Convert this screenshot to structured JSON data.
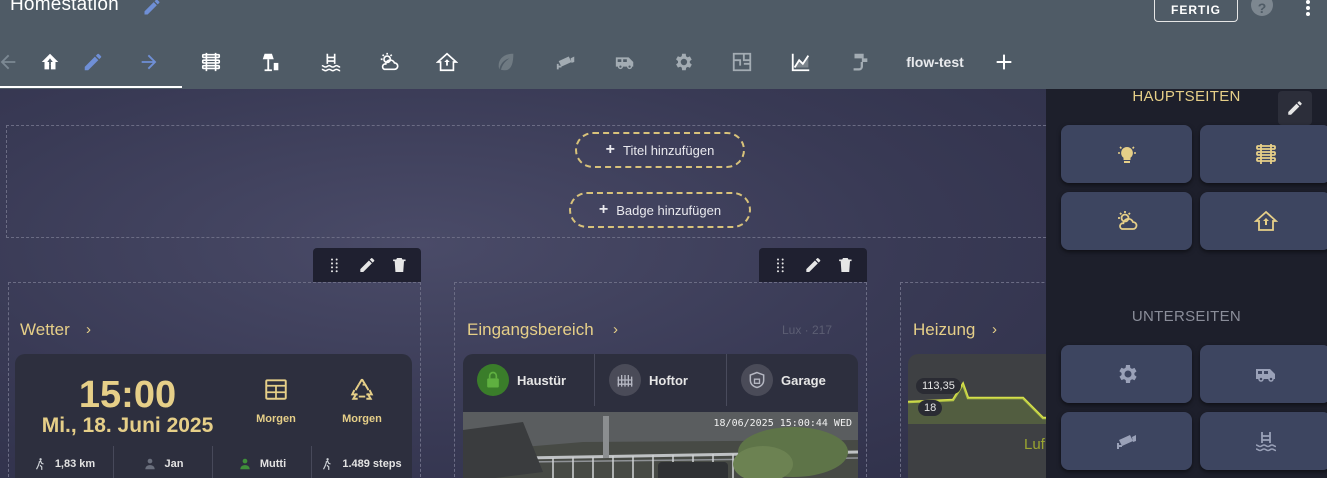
{
  "app": {
    "title": "Homestation",
    "done_label": "FERTIG",
    "help_glyph": "?"
  },
  "tabs": [
    {
      "icon": "back-arrow-icon"
    },
    {
      "icon": "home-tree-icon",
      "active": true
    },
    {
      "icon": "pencil-icon"
    },
    {
      "icon": "forward-arrow-icon"
    },
    {
      "icon": "radiator-icon"
    },
    {
      "icon": "outdoor-lamp-icon"
    },
    {
      "icon": "pool-icon"
    },
    {
      "icon": "weather-partly-cloudy-icon"
    },
    {
      "icon": "home-icon"
    },
    {
      "icon": "leaf-icon"
    },
    {
      "icon": "security-camera-icon"
    },
    {
      "icon": "van-icon"
    },
    {
      "icon": "gear-icon"
    },
    {
      "icon": "floor-plan-icon"
    },
    {
      "icon": "chart-icon"
    },
    {
      "icon": "faucet-icon"
    },
    {
      "label": "flow-test"
    },
    {
      "icon": "plus-icon"
    }
  ],
  "main": {
    "add_title": "Titel hinzufügen",
    "add_badge": "Badge hinzufügen",
    "sections": {
      "weather": {
        "title": "Wetter",
        "chevron": "›",
        "time": "15:00",
        "date": "Mi., 18. Juni 2025",
        "tiles": [
          {
            "icon": "calendar-icon",
            "label": "Morgen"
          },
          {
            "icon": "recycle-icon",
            "label": "Morgen"
          }
        ],
        "stats": [
          {
            "icon": "walk-icon",
            "value": "1,83 km"
          },
          {
            "icon": "person-icon",
            "value": "Jan"
          },
          {
            "icon": "person-green-icon",
            "value": "Mutti"
          },
          {
            "icon": "walk-icon",
            "value": "1.489 steps"
          }
        ]
      },
      "entrance": {
        "title": "Eingangsbereich",
        "chevron": "›",
        "lux": "Lux · 217",
        "doors": [
          {
            "icon": "lock-icon",
            "label": "Haustür",
            "color": "#3a7d2a"
          },
          {
            "icon": "gate-icon",
            "label": "Hoftor",
            "color": "#4a4b58"
          },
          {
            "icon": "garage-shield-icon",
            "label": "Garage",
            "color": "#4a4b58"
          }
        ],
        "camera_timestamp": "18/06/2025 15:00:44 WED"
      },
      "heating": {
        "title": "Heizung",
        "chevron": "›",
        "value_top": "113,35",
        "value_bottom": "18",
        "partial_label": "Luf"
      }
    }
  },
  "panel": {
    "primary_heading": "HAUPTSEITEN",
    "secondary_heading": "UNTERSEITEN",
    "primary_buttons": [
      {
        "icon": "light-bulb-icon"
      },
      {
        "icon": "radiator-icon"
      },
      {
        "icon": "weather-partly-cloudy-icon"
      },
      {
        "icon": "home-icon"
      }
    ],
    "secondary_buttons": [
      {
        "icon": "gear-icon"
      },
      {
        "icon": "van-icon"
      },
      {
        "icon": "security-camera-icon"
      },
      {
        "icon": "pool-icon"
      }
    ]
  },
  "colors": {
    "accent_gold": "#e6cf88",
    "header_bg": "#4f5b66",
    "panel_bg": "#1d1f2b",
    "tile_bg": "#3d4560"
  }
}
